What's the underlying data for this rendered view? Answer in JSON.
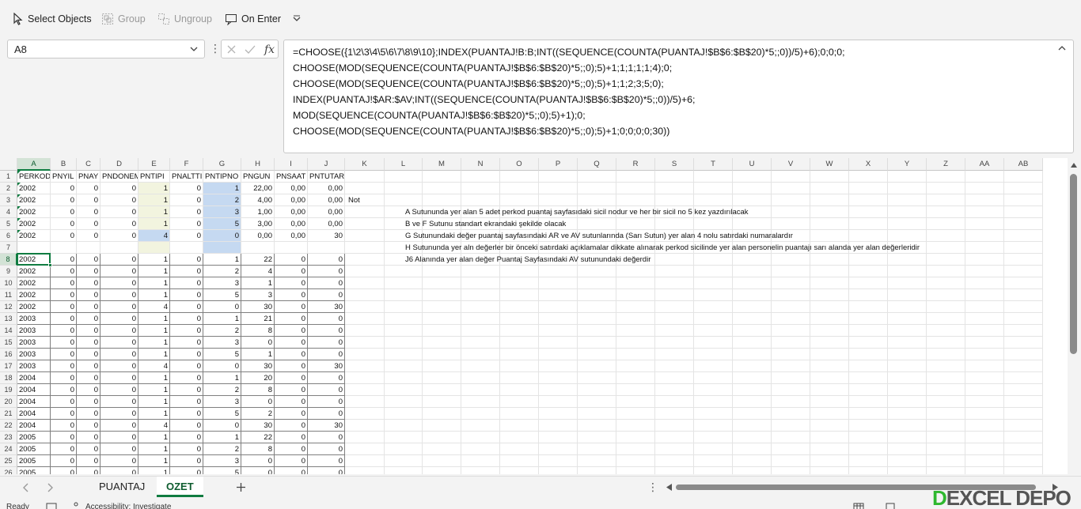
{
  "ribbon": {
    "select_objects": "Select Objects",
    "group": "Group",
    "ungroup": "Ungroup",
    "on_enter": "On Enter"
  },
  "name_box": {
    "value": "A8"
  },
  "formula_bar": {
    "lines": [
      "=CHOOSE({1\\2\\3\\4\\5\\6\\7\\8\\9\\10};INDEX(PUANTAJ!B:B;INT((SEQUENCE(COUNTA(PUANTAJ!$B$6:$B$20)*5;;0))/5)+6);0;0;0;",
      "CHOOSE(MOD(SEQUENCE(COUNTA(PUANTAJ!$B$6:$B$20)*5;;0);5)+1;1;1;1;1;4);0;",
      "CHOOSE(MOD(SEQUENCE(COUNTA(PUANTAJ!$B$6:$B$20)*5;;0);5)+1;1;2;3;5;0);",
      "INDEX(PUANTAJ!$AR:$AV;INT((SEQUENCE(COUNTA(PUANTAJ!$B$6:$B$20)*5;;0))/5)+6;",
      "MOD(SEQUENCE(COUNTA(PUANTAJ!$B$6:$B$20)*5;;0);5)+1);0;",
      "CHOOSE(MOD(SEQUENCE(COUNTA(PUANTAJ!$B$6:$B$20)*5;;0);5)+1;0;0;0;0;30))"
    ]
  },
  "grid": {
    "columns": [
      "A",
      "B",
      "C",
      "D",
      "E",
      "F",
      "G",
      "H",
      "I",
      "J",
      "K",
      "L",
      "M",
      "N",
      "O",
      "P",
      "Q",
      "R",
      "S",
      "T",
      "U",
      "V",
      "W",
      "X",
      "Y",
      "Z",
      "AA",
      "AB"
    ],
    "row_numbers": [
      "1",
      "2",
      "3",
      "4",
      "5",
      "6",
      "7",
      "8",
      "9",
      "10",
      "11",
      "12",
      "13",
      "14",
      "15",
      "16",
      "17",
      "18",
      "19",
      "20",
      "21",
      "22",
      "23",
      "24",
      "25",
      "26"
    ],
    "header_row": [
      "PERKOD",
      "PNYIL",
      "PNAY",
      "PNDONEM",
      "PNTIPI",
      "PNALTTIP",
      "PNTIPNO",
      "PNGUN",
      "PNSAAT",
      "PNTUTAR"
    ],
    "top_rows": [
      [
        "2002",
        "0",
        "0",
        "0",
        "1",
        "0",
        "1",
        "22,00",
        "0,00",
        "0,00"
      ],
      [
        "2002",
        "0",
        "0",
        "0",
        "1",
        "0",
        "2",
        "4,00",
        "0,00",
        "0,00"
      ],
      [
        "2002",
        "0",
        "0",
        "0",
        "1",
        "0",
        "3",
        "1,00",
        "0,00",
        "0,00"
      ],
      [
        "2002",
        "0",
        "0",
        "0",
        "1",
        "0",
        "5",
        "3,00",
        "0,00",
        "0,00"
      ],
      [
        "2002",
        "0",
        "0",
        "0",
        "4",
        "0",
        "0",
        "0,00",
        "0,00",
        "30"
      ]
    ],
    "spill_rows": [
      [
        "2002",
        "0",
        "0",
        "0",
        "1",
        "0",
        "1",
        "22",
        "0",
        "0"
      ],
      [
        "2002",
        "0",
        "0",
        "0",
        "1",
        "0",
        "2",
        "4",
        "0",
        "0"
      ],
      [
        "2002",
        "0",
        "0",
        "0",
        "1",
        "0",
        "3",
        "1",
        "0",
        "0"
      ],
      [
        "2002",
        "0",
        "0",
        "0",
        "1",
        "0",
        "5",
        "3",
        "0",
        "0"
      ],
      [
        "2002",
        "0",
        "0",
        "0",
        "4",
        "0",
        "0",
        "30",
        "0",
        "30"
      ],
      [
        "2003",
        "0",
        "0",
        "0",
        "1",
        "0",
        "1",
        "21",
        "0",
        "0"
      ],
      [
        "2003",
        "0",
        "0",
        "0",
        "1",
        "0",
        "2",
        "8",
        "0",
        "0"
      ],
      [
        "2003",
        "0",
        "0",
        "0",
        "1",
        "0",
        "3",
        "0",
        "0",
        "0"
      ],
      [
        "2003",
        "0",
        "0",
        "0",
        "1",
        "0",
        "5",
        "1",
        "0",
        "0"
      ],
      [
        "2003",
        "0",
        "0",
        "0",
        "4",
        "0",
        "0",
        "30",
        "0",
        "30"
      ],
      [
        "2004",
        "0",
        "0",
        "0",
        "1",
        "0",
        "1",
        "20",
        "0",
        "0"
      ],
      [
        "2004",
        "0",
        "0",
        "0",
        "1",
        "0",
        "2",
        "8",
        "0",
        "0"
      ],
      [
        "2004",
        "0",
        "0",
        "0",
        "1",
        "0",
        "3",
        "0",
        "0",
        "0"
      ],
      [
        "2004",
        "0",
        "0",
        "0",
        "1",
        "0",
        "5",
        "2",
        "0",
        "0"
      ],
      [
        "2004",
        "0",
        "0",
        "0",
        "4",
        "0",
        "0",
        "30",
        "0",
        "30"
      ],
      [
        "2005",
        "0",
        "0",
        "0",
        "1",
        "0",
        "1",
        "22",
        "0",
        "0"
      ],
      [
        "2005",
        "0",
        "0",
        "0",
        "1",
        "0",
        "2",
        "8",
        "0",
        "0"
      ],
      [
        "2005",
        "0",
        "0",
        "0",
        "1",
        "0",
        "3",
        "0",
        "0",
        "0"
      ],
      [
        "2005",
        "0",
        "0",
        "0",
        "1",
        "0",
        "5",
        "0",
        "0",
        "0"
      ]
    ],
    "not_label": "Not",
    "notes": [
      "A Sutununda yer alan  5 adet perkod  puantaj sayfasıdaki sicil nodur ve her bir sicil no 5 kez yazdırılacak",
      "B ve F Sutunu standart ekrandaki şekilde olacak",
      "G Sutunundaki değer puantaj sayfasındaki AR ve AV sutunlarında (Sarı Sutun) yer alan 4 nolu satırdaki numaralardır",
      "H Sutununda yer aln değerler bir önceki satırdaki açıklamalar dikkate alınarak perkod sicilinde yer alan personelin puantajı sarı alanda yer alan değerleridir",
      "J6 Alanında yer alan değer Puantaj Sayfasındaki AV sutunundaki değerdir"
    ]
  },
  "sheet_tabs": [
    "PUANTAJ",
    "OZET"
  ],
  "active_tab": "OZET",
  "status": {
    "ready": "Ready",
    "accessibility": "Accessibility: Investigate"
  },
  "logo": {
    "text": "EXCEL DEPO"
  },
  "colors": {
    "accent": "#107c41",
    "highlight_yellow": "#f2f4df",
    "highlight_blue": "#c5d9f1"
  }
}
